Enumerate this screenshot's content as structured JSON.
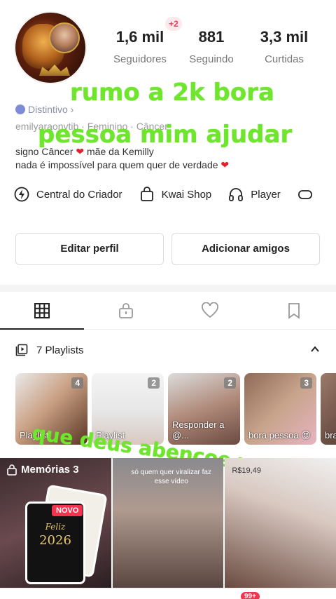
{
  "profile": {
    "stats": [
      {
        "value": "1,6 mil",
        "label": "Seguidores"
      },
      {
        "value": "881",
        "label": "Seguindo"
      },
      {
        "value": "3,3 mil",
        "label": "Curtidas"
      }
    ],
    "new_followers_badge": "+2",
    "distintivo": "Distintivo ›",
    "meta": "emilyaraonvtib · Feminino · Câncer",
    "bio_line1": "signo Câncer",
    "bio_line1b": "mãe da Kemilly",
    "bio_line2": "nada é impossível para quem quer de verdade",
    "heart": "❤"
  },
  "overlays": {
    "line1": "rumo a 2k bora",
    "line2": "pessoa mim ajudar",
    "line3": "que deus abençoe vcs"
  },
  "creator_row": [
    {
      "icon": "lightning-icon",
      "label": "Central do Criador"
    },
    {
      "icon": "shopping-bag-icon",
      "label": "Kwai Shop"
    },
    {
      "icon": "headphones-icon",
      "label": "Player"
    }
  ],
  "buttons": {
    "edit_profile": "Editar perfil",
    "add_friends": "Adicionar amigos"
  },
  "tabs": [
    {
      "icon": "grid-icon",
      "active": true
    },
    {
      "icon": "lock-icon",
      "active": false
    },
    {
      "icon": "heart-outline-icon",
      "active": false
    },
    {
      "icon": "bookmark-icon",
      "active": false
    }
  ],
  "playlists": {
    "header": "7 Playlists",
    "cards": [
      {
        "count": "4",
        "caption": "Playlist"
      },
      {
        "count": "2",
        "caption": "Playlist"
      },
      {
        "count": "2",
        "caption": "Responder a @..."
      },
      {
        "count": "3",
        "caption": "bora pessoa 😍"
      },
      {
        "count": "",
        "caption": "bra"
      }
    ]
  },
  "grid": {
    "memories_label": "Memórias 3",
    "novo": "NOVO",
    "card_title": "Feliz",
    "card_year": "2026",
    "video2_text": "só quem quer viralizar faz esse vídeo",
    "video3_price": "R$19,49"
  },
  "nav": {
    "badge": "99+"
  }
}
